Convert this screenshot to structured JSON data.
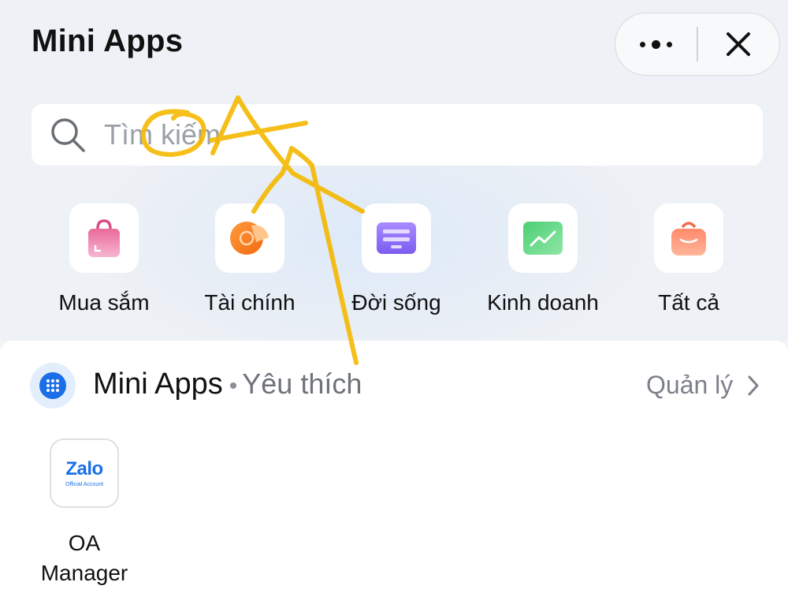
{
  "header": {
    "title": "Mini Apps"
  },
  "search": {
    "placeholder": "Tìm kiếm"
  },
  "categories": [
    {
      "label": "Mua sắm",
      "icon": "shopping-bag-icon"
    },
    {
      "label": "Tài chính",
      "icon": "finance-coin-icon"
    },
    {
      "label": "Đời sống",
      "icon": "lifestyle-card-icon"
    },
    {
      "label": "Kinh doanh",
      "icon": "business-chart-icon"
    },
    {
      "label": "Tất cả",
      "icon": "all-basket-icon"
    }
  ],
  "favorites": {
    "title": "Mini Apps",
    "subtitle": "Yêu thích",
    "manage_label": "Quản lý",
    "apps": [
      {
        "logo_word": "Zalo",
        "logo_sub": "Official Account",
        "label_line1": "OA",
        "label_line2": "Manager"
      }
    ]
  },
  "colors": {
    "accent": "#1a6fe8",
    "scribble": "#f5b800"
  }
}
